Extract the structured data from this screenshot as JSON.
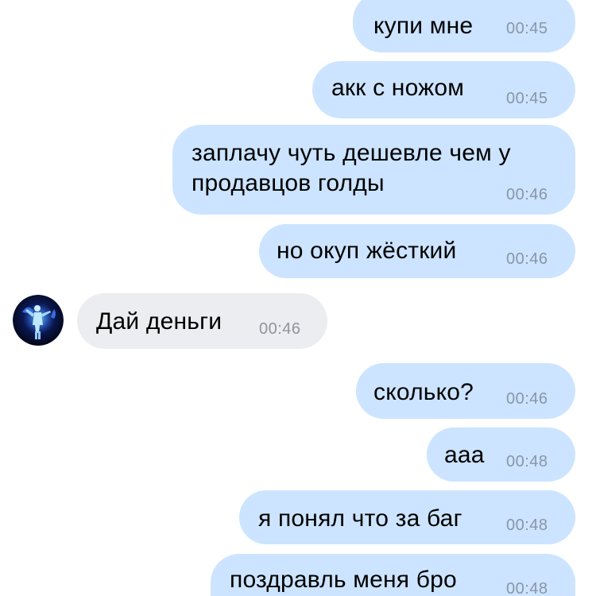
{
  "messages": [
    {
      "direction": "out",
      "text": "купи мне",
      "time": "00:45"
    },
    {
      "direction": "out",
      "text": "акк с ножом",
      "time": "00:45"
    },
    {
      "direction": "out",
      "lines": [
        "заплачу чуть дешевле чем у",
        "продавцов голды"
      ],
      "time": "00:46"
    },
    {
      "direction": "out",
      "text": "но окуп жёсткий",
      "time": "00:46"
    },
    {
      "direction": "in",
      "text": "Дай деньги",
      "time": "00:46",
      "avatar": "user-avatar-neon-figure"
    },
    {
      "direction": "out",
      "text": "сколько?",
      "time": "00:46"
    },
    {
      "direction": "out",
      "text": "ааа",
      "time": "00:48"
    },
    {
      "direction": "out",
      "text": "я понял что за баг",
      "time": "00:48"
    },
    {
      "direction": "out",
      "text": "поздравль меня бро",
      "time": "00:48"
    }
  ],
  "colors": {
    "outgoing_bubble": "#cce4ff",
    "incoming_bubble": "#ebedf0",
    "timestamp": "#8a96a6",
    "background": "#ffffff"
  }
}
